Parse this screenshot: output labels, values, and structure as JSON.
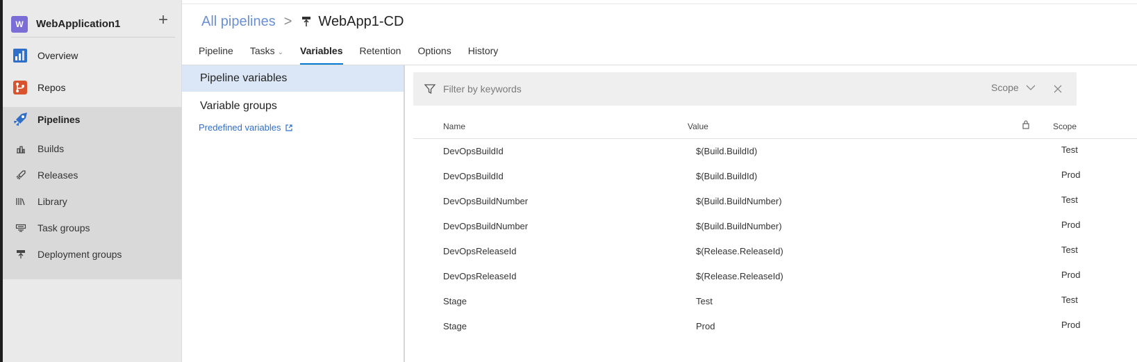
{
  "project": {
    "avatar_letter": "W",
    "name": "WebApplication1",
    "add_label": "+"
  },
  "nav": {
    "overview": "Overview",
    "repos": "Repos",
    "pipelines": "Pipelines",
    "sub": {
      "builds": "Builds",
      "releases": "Releases",
      "library": "Library",
      "task_groups": "Task groups",
      "deployment_groups": "Deployment groups"
    }
  },
  "breadcrumb": {
    "all": "All pipelines",
    "separator": ">",
    "title": "WebApp1-CD"
  },
  "tabs": [
    "Pipeline",
    "Tasks",
    "Variables",
    "Retention",
    "Options",
    "History"
  ],
  "active_tab": "Variables",
  "panel": {
    "pipeline_variables": "Pipeline variables",
    "variable_groups": "Variable groups",
    "predefined_link": "Predefined variables"
  },
  "filter": {
    "placeholder": "Filter by keywords",
    "scope_label": "Scope"
  },
  "table": {
    "headers": {
      "name": "Name",
      "value": "Value",
      "scope": "Scope"
    },
    "rows": [
      {
        "name": "DevOpsBuildId",
        "value": "$(Build.BuildId)",
        "scope": "Test"
      },
      {
        "name": "DevOpsBuildId",
        "value": "$(Build.BuildId)",
        "scope": "Prod"
      },
      {
        "name": "DevOpsBuildNumber",
        "value": "$(Build.BuildNumber)",
        "scope": "Test"
      },
      {
        "name": "DevOpsBuildNumber",
        "value": "$(Build.BuildNumber)",
        "scope": "Prod"
      },
      {
        "name": "DevOpsReleaseId",
        "value": "$(Release.ReleaseId)",
        "scope": "Test"
      },
      {
        "name": "DevOpsReleaseId",
        "value": "$(Release.ReleaseId)",
        "scope": "Prod"
      },
      {
        "name": "Stage",
        "value": "Test",
        "scope": "Test"
      },
      {
        "name": "Stage",
        "value": "Prod",
        "scope": "Prod"
      }
    ]
  },
  "colors": {
    "accent": "#0078d4",
    "link": "#2f6fc9",
    "breadcrumb": "#6b8fd4",
    "avatar": "#7a6dd6"
  },
  "icons": [
    "plus-icon",
    "overview-icon",
    "repos-icon",
    "pipelines-icon",
    "builds-icon",
    "releases-icon",
    "library-icon",
    "task-groups-icon",
    "deployment-groups-icon",
    "release-pipeline-icon",
    "chevron-down-icon",
    "external-link-icon",
    "filter-icon",
    "close-icon",
    "lock-icon"
  ]
}
